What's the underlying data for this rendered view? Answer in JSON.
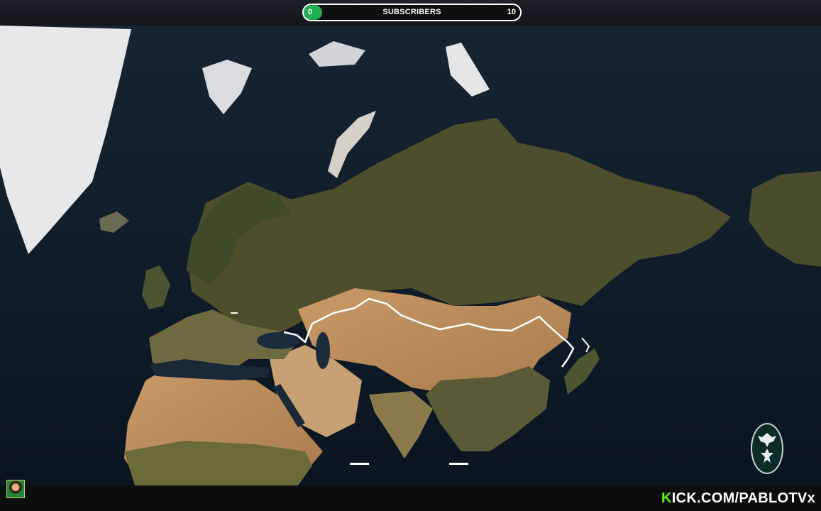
{
  "subscribers": {
    "min": "0",
    "max": "10",
    "label": "SUBSCRIBERS",
    "progress_fraction": 0.0
  },
  "footer": {
    "kick_k": "K",
    "kick_rest": "ICK.COM/PABLOTVx"
  },
  "colors": {
    "progress_green": "#1fae52",
    "kick_green": "#53fc18",
    "border_outline": "#ffffff"
  }
}
